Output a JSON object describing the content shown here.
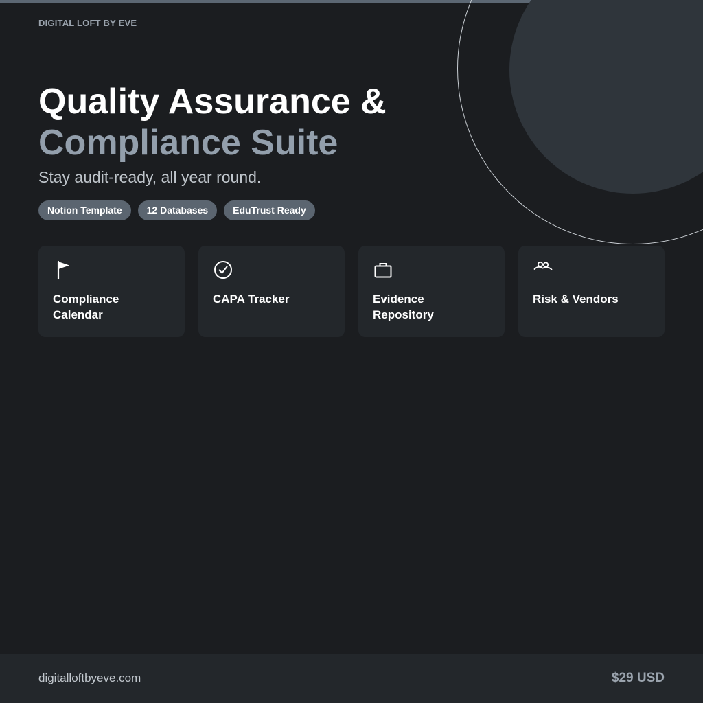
{
  "brand": "DIGITAL LOFT BY EVE",
  "headline": {
    "line1": "Quality Assurance &",
    "line2": "Compliance Suite"
  },
  "tagline": "Stay audit-ready, all year round.",
  "pills": [
    "Notion Template",
    "12 Databases",
    "EduTrust Ready"
  ],
  "cards": [
    {
      "icon": "flag-icon",
      "title": "Compliance Calendar"
    },
    {
      "icon": "check-circle-icon",
      "title": "CAPA Tracker"
    },
    {
      "icon": "briefcase-icon",
      "title": "Evidence Repository"
    },
    {
      "icon": "people-icon",
      "title": "Risk & Vendors"
    }
  ],
  "footer": {
    "url": "digitalloftbyeve.com",
    "price": "$29 USD"
  },
  "colors": {
    "background": "#1b1d20",
    "card": "#23272b",
    "pill": "#5b6570",
    "accent_text": "#939fac",
    "decor_circle": "#2f353b"
  }
}
